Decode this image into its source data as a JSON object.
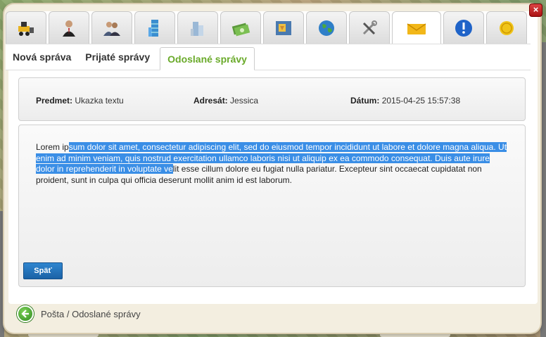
{
  "window": {
    "close_label": "×"
  },
  "toolbar": {
    "icons": [
      "bulldozer-icon",
      "businessman-icon",
      "people-icon",
      "building-icon",
      "office-icon",
      "money-icon",
      "map-icon",
      "globe-icon",
      "tools-icon",
      "mail-icon",
      "info-icon",
      "coin-icon"
    ],
    "active": "mail-icon"
  },
  "tabs": {
    "new_message": "Nová správa",
    "received": "Prijaté správy",
    "sent": "Odoslané správy"
  },
  "message": {
    "subject_label": "Predmet:",
    "subject": "Ukazka textu",
    "recipient_label": "Adresát:",
    "recipient": "Jessica",
    "date_label": "Dátum:",
    "date": "2015-04-25 15:57:38",
    "body_before": "Lorem ip",
    "body_selected": "sum dolor sit amet, consectetur adipiscing elit, sed do eiusmod tempor incididunt ut labore et dolore magna aliqua. Ut enim ad minim veniam, quis nostrud exercitation ullamco laboris nisi ut aliquip ex ea commodo consequat. Duis aute irure dolor in reprehenderit in voluptate ve",
    "body_after": "lit esse cillum dolore eu fugiat nulla pariatur. Excepteur sint occaecat cupidatat non proident, sunt in culpa qui officia deserunt mollit anim id est laborum.",
    "back_label": "Späť"
  },
  "footer": {
    "breadcrumb": "Pošta / Odoslané správy"
  },
  "colors": {
    "active_tab": "#6aaa2a",
    "button": "#1b62a6",
    "selection": "#3a8ee6"
  }
}
